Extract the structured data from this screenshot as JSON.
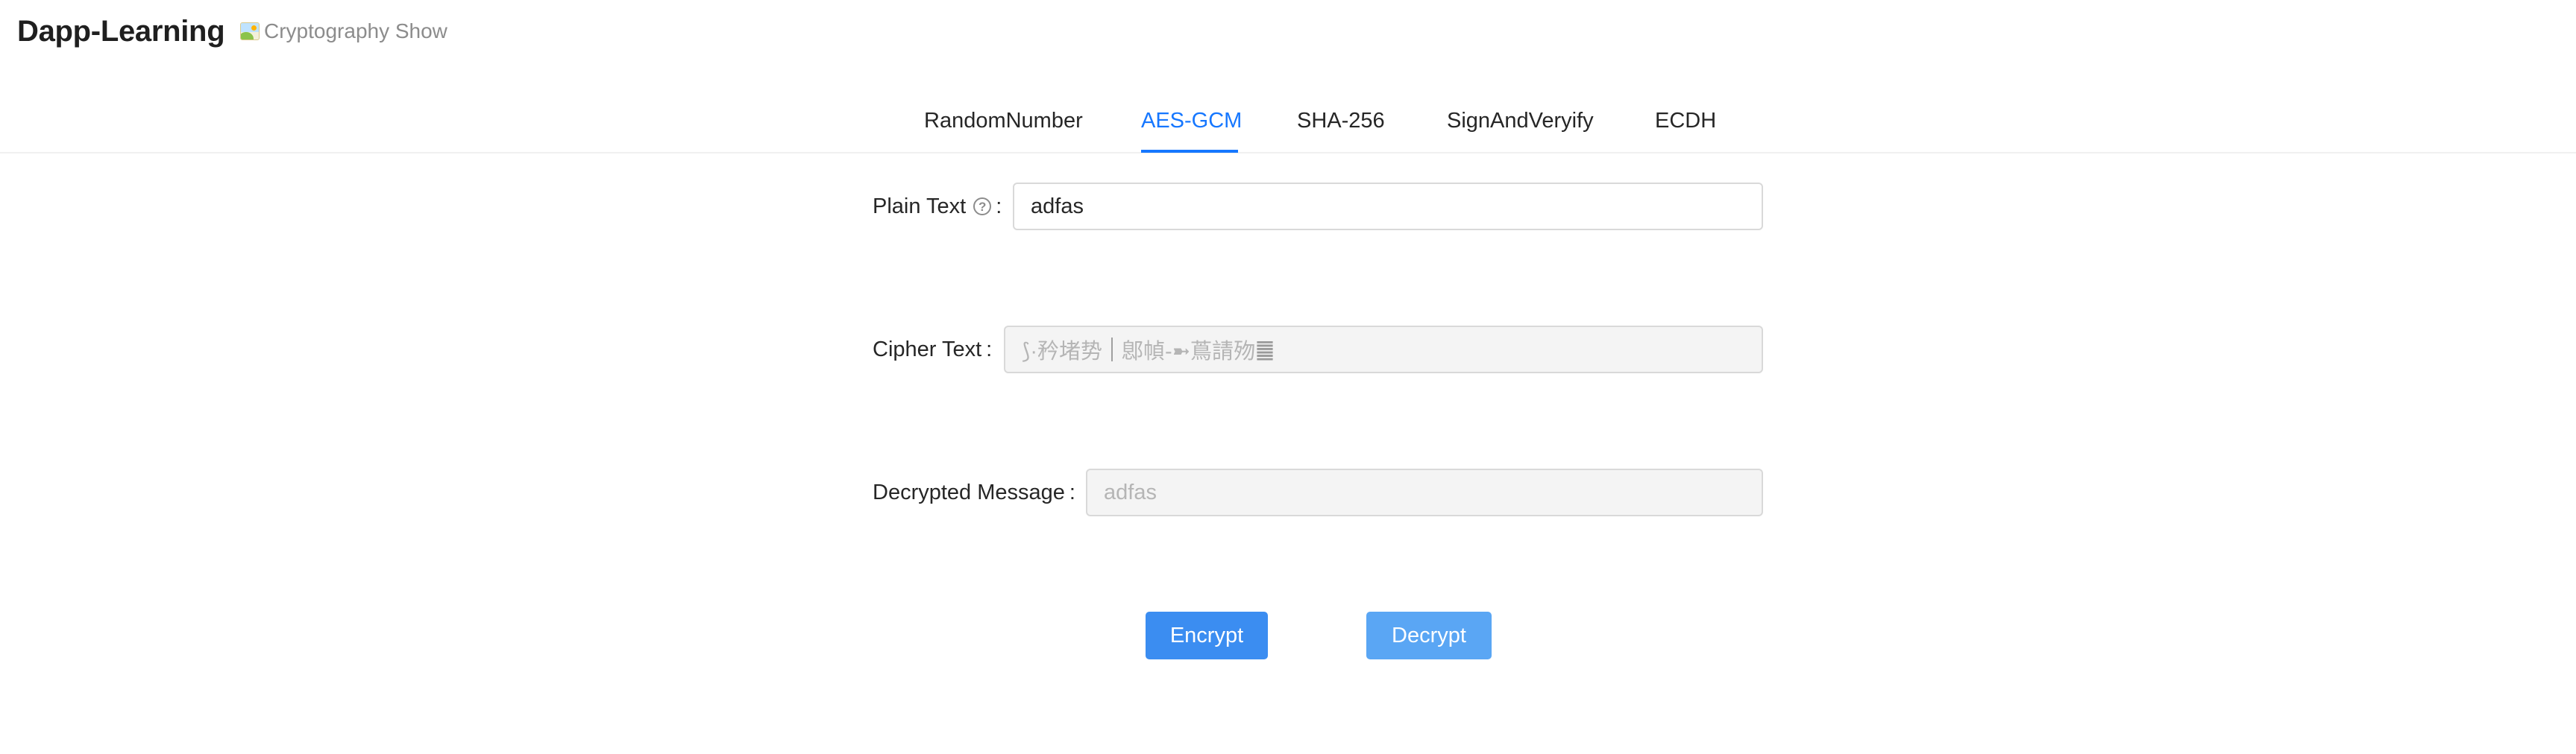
{
  "header": {
    "app_title": "Dapp-Learning",
    "subtitle": "Cryptography Show",
    "subtitle_icon": "picture-icon"
  },
  "tabs": [
    {
      "label": "RandomNumber",
      "active": false
    },
    {
      "label": "AES-GCM",
      "active": true
    },
    {
      "label": "SHA-256",
      "active": false
    },
    {
      "label": "SignAndVeryify",
      "active": false
    },
    {
      "label": "ECDH",
      "active": false
    }
  ],
  "form": {
    "plain_text": {
      "label": "Plain Text",
      "help_icon": "question-circle-icon",
      "value": "adfas"
    },
    "cipher_text": {
      "label": "Cipher Text",
      "value_part1": "⟆·矜堵势",
      "value_part2": "鄎幀-➼蔦請歾",
      "value_tail": "䷀"
    },
    "decrypted": {
      "label": "Decrypted Message",
      "value": "adfas"
    }
  },
  "buttons": {
    "encrypt_label": "Encrypt",
    "decrypt_label": "Decrypt"
  },
  "colors": {
    "accent": "#1677ff",
    "encrypt_button": "#3b8df1",
    "decrypt_button": "#5aa6f4",
    "disabled_field": "#f4f4f4"
  }
}
